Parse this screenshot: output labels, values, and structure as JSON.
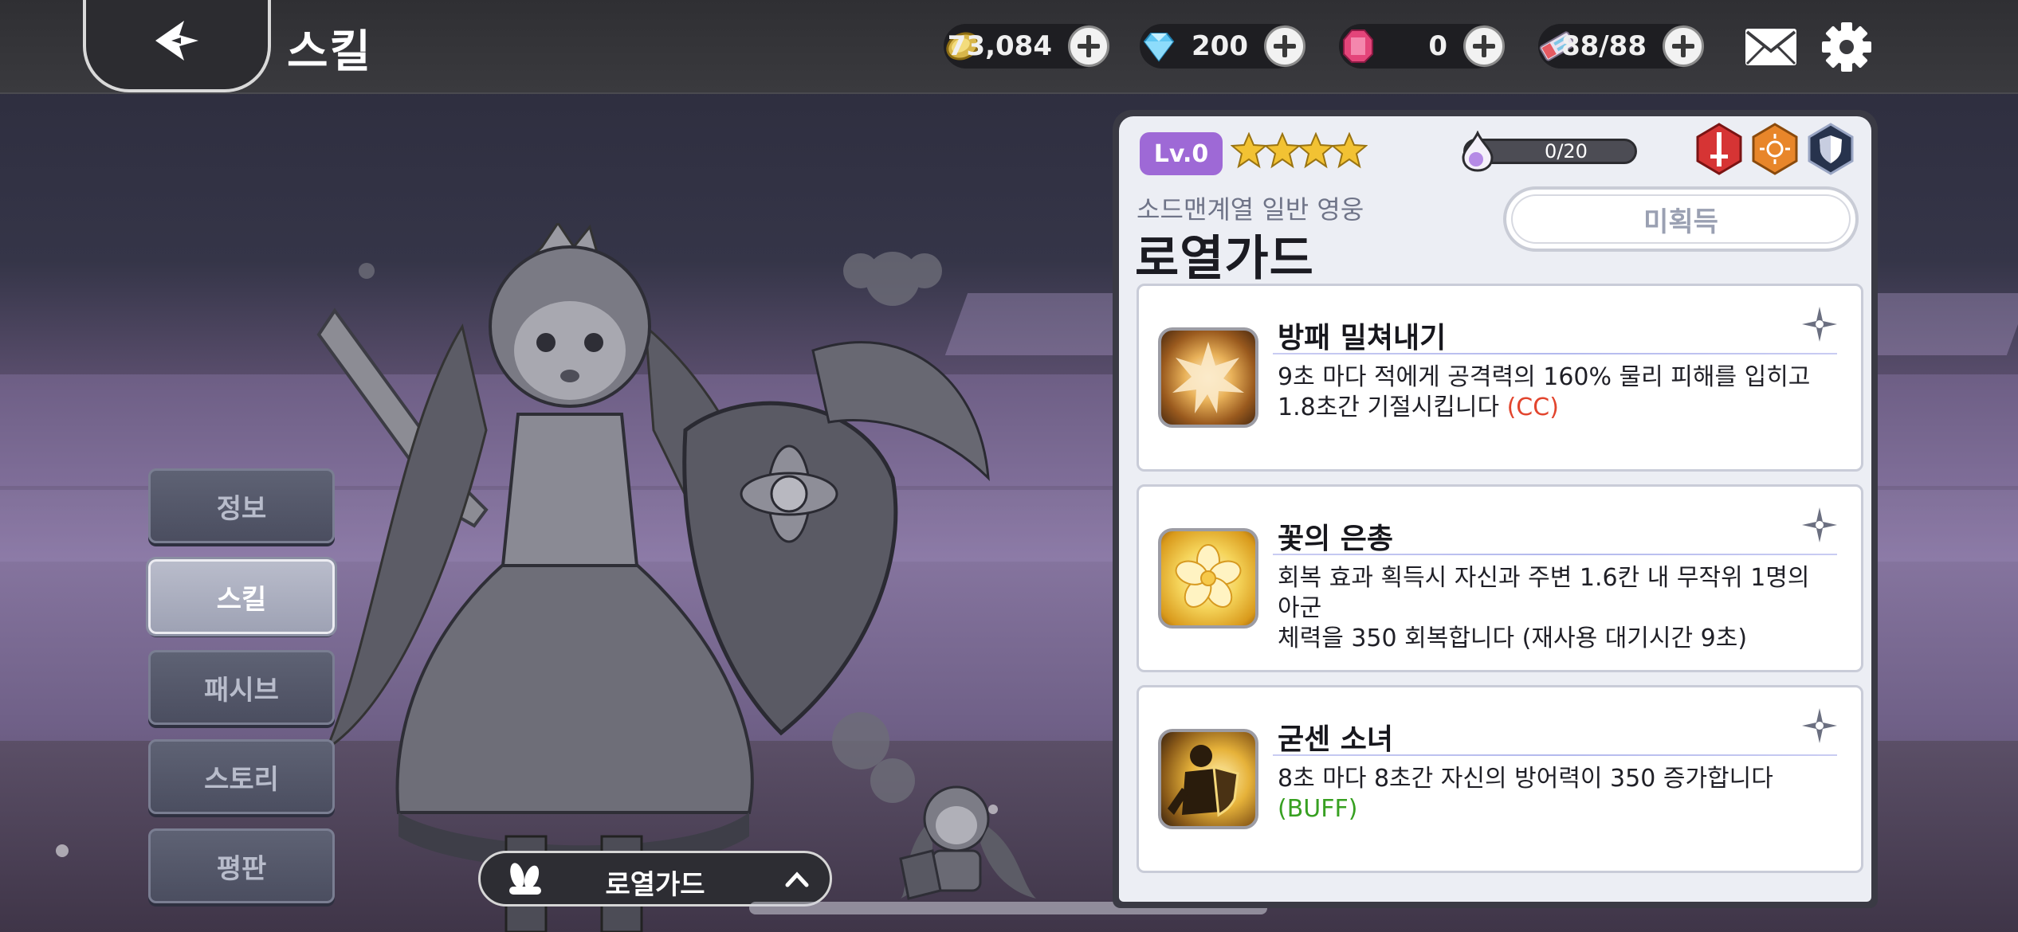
{
  "header": {
    "title": "스킬",
    "currencies": [
      {
        "icon": "gold-coin-icon",
        "value": "73,084"
      },
      {
        "icon": "diamond-icon",
        "value": "200"
      },
      {
        "icon": "ruby-gem-icon",
        "value": "0"
      },
      {
        "icon": "stamina-ticket-icon",
        "value": "88/88"
      }
    ]
  },
  "side_menu": {
    "items": [
      {
        "label": "정보",
        "active": false
      },
      {
        "label": "스킬",
        "active": true
      },
      {
        "label": "패시브",
        "active": false
      },
      {
        "label": "스토리",
        "active": false
      },
      {
        "label": "평판",
        "active": false
      }
    ]
  },
  "hero_selector": {
    "name": "로열가드"
  },
  "hero": {
    "level": "Lv.0",
    "stars": 4,
    "essence": "0/20",
    "subtitle": "소드맨계열 일반 영웅",
    "name": "로열가드",
    "status": "미획득",
    "class_icons": [
      "sword-class-icon",
      "sun-element-icon",
      "shield-role-icon"
    ]
  },
  "skills": [
    {
      "title": "방패 밀쳐내기",
      "desc_line1": "9초 마다 적에게 공격력의 160% 물리 피해를 입히고",
      "desc_line2": "1.8초간 기절시킵니다",
      "tag": "(CC)"
    },
    {
      "title": "꽃의 은총",
      "desc_line1": "회복 효과 획득시 자신과 주변 1.6칸 내 무작위 1명의 아군",
      "desc_line2": "체력을 350 회복합니다 (재사용 대기시간 9초)",
      "tag": ""
    },
    {
      "title": "굳센 소녀",
      "desc_line1": "8초 마다 8초간 자신의 방어력이 350 증가합니다",
      "desc_line2": "",
      "tag": "(BUFF)"
    }
  ],
  "colors": {
    "level_badge": "#9e69d6",
    "cc_tag": "#e2452e",
    "buff_tag": "#37a021",
    "star": "#f2c233"
  }
}
